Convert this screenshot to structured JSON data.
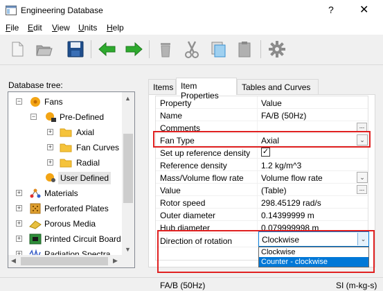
{
  "window": {
    "title": "Engineering Database",
    "help_glyph": "?",
    "close_glyph": "✕"
  },
  "menu": [
    {
      "underline": "F",
      "rest": "ile"
    },
    {
      "underline": "E",
      "rest": "dit"
    },
    {
      "underline": "V",
      "rest": "iew"
    },
    {
      "underline": "U",
      "rest": "nits"
    },
    {
      "underline": "H",
      "rest": "elp"
    }
  ],
  "tree": {
    "label": "Database tree:",
    "items": [
      {
        "label": "Fans"
      },
      {
        "label": "Pre-Defined"
      },
      {
        "label": "Axial"
      },
      {
        "label": "Fan Curves"
      },
      {
        "label": "Radial"
      },
      {
        "label": "User Defined"
      },
      {
        "label": "Materials"
      },
      {
        "label": "Perforated Plates"
      },
      {
        "label": "Porous Media"
      },
      {
        "label": "Printed Circuit Board"
      },
      {
        "label": "Radiation Spectra"
      }
    ]
  },
  "tabs": [
    {
      "label": "Items"
    },
    {
      "label": "Item Properties"
    },
    {
      "label": "Tables and Curves"
    }
  ],
  "properties": {
    "header": {
      "name": "Property",
      "value": "Value"
    },
    "rows": [
      {
        "name": "Name",
        "value": "FA/B (50Hz)"
      },
      {
        "name": "Comments",
        "value": ""
      },
      {
        "name": "Fan Type",
        "value": "Axial"
      },
      {
        "name": "Set up reference density",
        "value": "✓"
      },
      {
        "name": "Reference density",
        "value": "1.2 kg/m^3"
      },
      {
        "name": "Mass/Volume flow rate",
        "value": "Volume flow rate"
      },
      {
        "name": "Value",
        "value": "(Table)"
      },
      {
        "name": "Rotor speed",
        "value": "298.45129 rad/s"
      },
      {
        "name": "Outer diameter",
        "value": "0.14399999 m"
      },
      {
        "name": "Hub diameter",
        "value": "0.079999998 m"
      },
      {
        "name": "Direction of rotation",
        "value": "Clockwise"
      }
    ],
    "ellipsis": "...",
    "combo_arrow": "⌄"
  },
  "dropdown": {
    "selected": "Clockwise",
    "options": [
      {
        "label": "Clockwise"
      },
      {
        "label": "Counter - clockwise"
      }
    ]
  },
  "status": {
    "item": "FA/B (50Hz)",
    "units": "SI (m-kg-s)"
  },
  "colors": {
    "highlight": "#e02020",
    "selection": "#0078d7",
    "accent_green": "#2eaa2e"
  }
}
